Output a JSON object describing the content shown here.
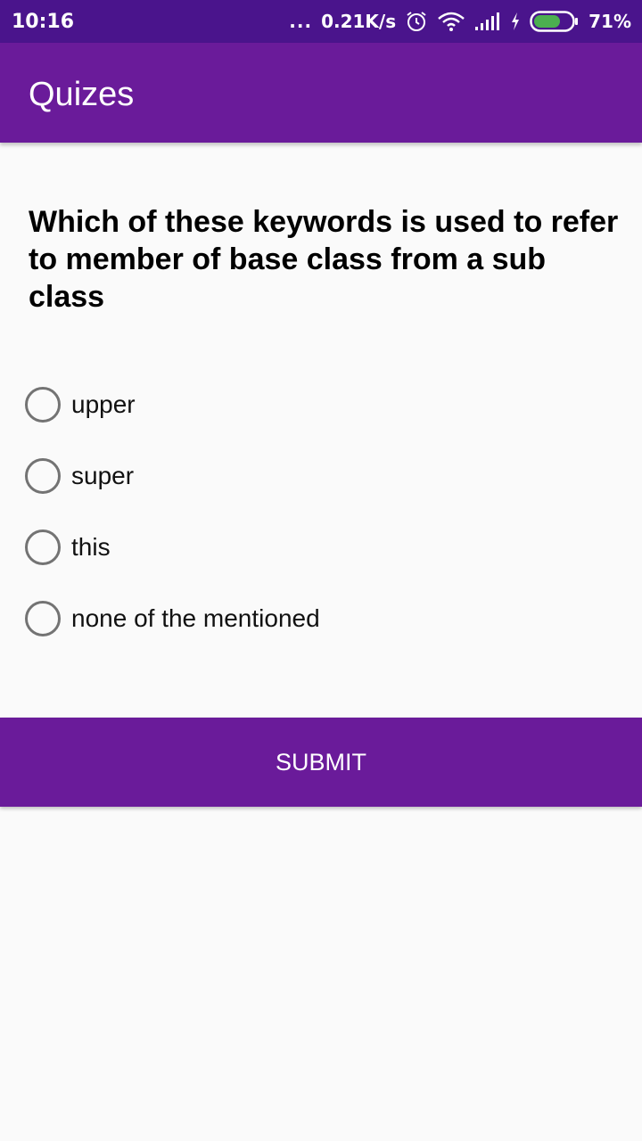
{
  "status_bar": {
    "time": "10:16",
    "more_dots": "...",
    "net_speed": "0.21K/s",
    "battery": "71%",
    "icons": [
      "alarm-icon",
      "wifi-icon",
      "signal-icon",
      "charging-icon",
      "battery-icon"
    ],
    "battery_level": 0.71,
    "battery_color": "#4caf50"
  },
  "app_bar": {
    "title": "Quizes",
    "color": "#6a1b9a"
  },
  "question": {
    "text": "Which of these keywords is used to refer to member of base class from a sub class"
  },
  "options": [
    {
      "label": "upper",
      "selected": false
    },
    {
      "label": "super",
      "selected": false
    },
    {
      "label": "this",
      "selected": false
    },
    {
      "label": "none of the mentioned",
      "selected": false
    }
  ],
  "submit": {
    "label": "SUBMIT"
  },
  "colors": {
    "status_bar": "#4a148c",
    "primary": "#6a1b9a",
    "background": "#fafafa",
    "radio_border": "#737373"
  }
}
